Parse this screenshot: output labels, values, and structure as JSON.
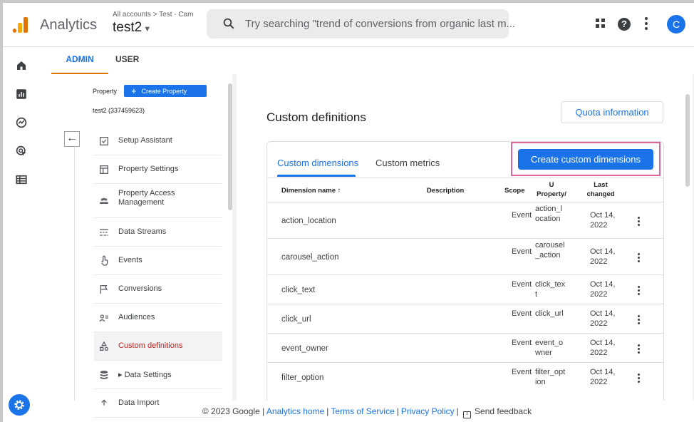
{
  "header": {
    "app_name": "Analytics",
    "breadcrumb": "All accounts > Test - Cam",
    "account_name": "test2",
    "search_placeholder": "Try searching \"trend of conversions from organic last m...",
    "avatar_letter": "C"
  },
  "admin_tabs": {
    "admin": "ADMIN",
    "user": "USER"
  },
  "property": {
    "label": "Property",
    "create_button": "Create Property",
    "id_text": "test2 (337459623)"
  },
  "nav": {
    "items": [
      {
        "label": "Setup Assistant",
        "icon": "checkbox-icon"
      },
      {
        "label": "Property Settings",
        "icon": "property-settings-icon"
      },
      {
        "label": "Property Access Management",
        "icon": "people-icon"
      },
      {
        "label": "Data Streams",
        "icon": "data-streams-icon"
      },
      {
        "label": "Events",
        "icon": "touch-icon"
      },
      {
        "label": "Conversions",
        "icon": "flag-icon"
      },
      {
        "label": "Audiences",
        "icon": "audiences-icon"
      },
      {
        "label": "Custom definitions",
        "icon": "custom-definitions-icon"
      },
      {
        "label": "▸ Data Settings",
        "icon": "database-icon"
      },
      {
        "label": "Data Import",
        "icon": "upload-icon"
      }
    ],
    "active_index": 7
  },
  "main": {
    "title": "Custom definitions",
    "quota_button": "Quota information",
    "tabs": {
      "dimensions": "Custom dimensions",
      "metrics": "Custom metrics"
    },
    "create_button": "Create custom dimensions",
    "columns": {
      "name": "Dimension name",
      "sort_arrow": "↑",
      "description": "Description",
      "scope": "Scope",
      "param_line1": "U",
      "param_line2": "Property/",
      "changed_line1": "Last",
      "changed_line2": "changed"
    },
    "rows": [
      {
        "name": "action_location",
        "scope": "Event",
        "param": "action_location",
        "date": "Oct 14, 2022"
      },
      {
        "name": "carousel_action",
        "scope": "Event",
        "param": "carousel_action",
        "date": "Oct 14, 2022"
      },
      {
        "name": "click_text",
        "scope": "Event",
        "param": "click_text",
        "date": "Oct 14, 2022"
      },
      {
        "name": "click_url",
        "scope": "Event",
        "param": "click_url",
        "date": "Oct 14, 2022"
      },
      {
        "name": "event_owner",
        "scope": "Event",
        "param": "event_owner",
        "date": "Oct 14, 2022"
      },
      {
        "name": "filter_option",
        "scope": "Event",
        "param": "filter_option",
        "date": "Oct 14, 2022"
      }
    ]
  },
  "footer": {
    "copyright": "© 2023 Google |",
    "links": [
      "Analytics home",
      "Terms of Service",
      "Privacy Policy"
    ],
    "feedback": "Send feedback"
  },
  "colors": {
    "brand_blue": "#1a73e8",
    "admin_underline": "#e37400",
    "highlight_box": "#e0659a",
    "active_nav_text": "#c5221f"
  }
}
